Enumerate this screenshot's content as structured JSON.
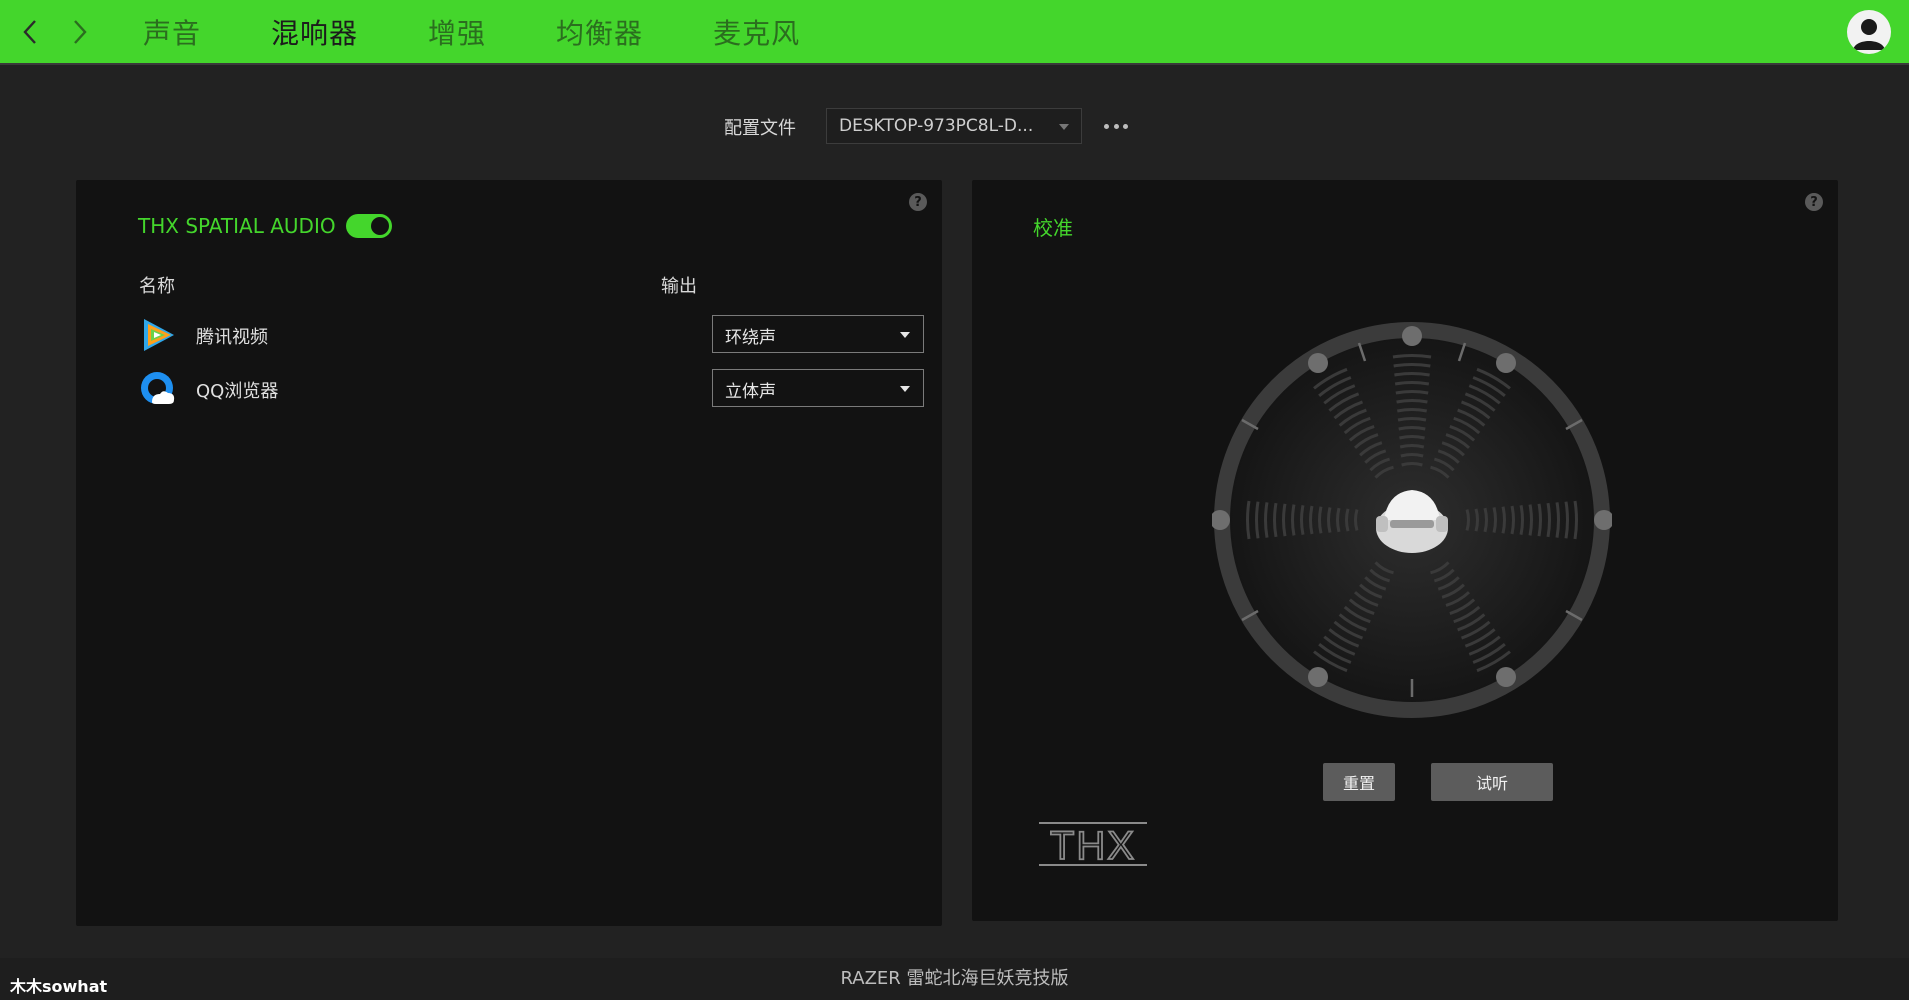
{
  "header": {
    "tabs": [
      {
        "label": "声音",
        "active": false
      },
      {
        "label": "混响器",
        "active": true
      },
      {
        "label": "增强",
        "active": false
      },
      {
        "label": "均衡器",
        "active": false
      },
      {
        "label": "麦克风",
        "active": false
      }
    ],
    "back_icon": "chevron-left-icon",
    "forward_icon": "chevron-right-icon",
    "avatar_icon": "user-avatar-icon"
  },
  "profile": {
    "label": "配置文件",
    "value": "DESKTOP-973PC8L-D...",
    "more_icon": "more-dots-icon"
  },
  "mixer": {
    "title": "THX SPATIAL AUDIO",
    "enabled": true,
    "col_name": "名称",
    "col_output": "输出",
    "apps": [
      {
        "name": "腾讯视频",
        "output": "环绕声",
        "icon": "tencent-video-icon"
      },
      {
        "name": "QQ浏览器",
        "output": "立体声",
        "icon": "qq-browser-icon"
      }
    ],
    "help": "?"
  },
  "calibration": {
    "title": "校准",
    "reset_label": "重置",
    "test_label": "试听",
    "help": "?",
    "logo": "THX"
  },
  "footer": {
    "device": "RAZER 雷蛇北海巨妖竞技版",
    "watermark": "木木sowhat"
  },
  "colors": {
    "accent": "#44d62c",
    "background": "#222222",
    "panel": "#121212"
  }
}
